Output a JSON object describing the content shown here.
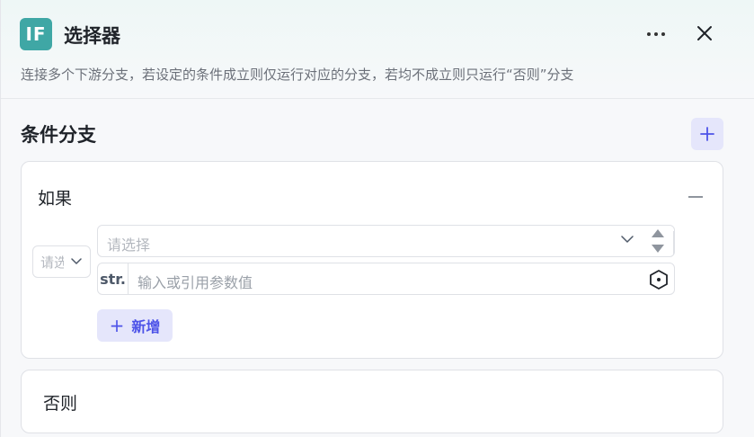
{
  "header": {
    "icon_text": "IF",
    "title": "选择器",
    "description": "连接多个下游分支，若设定的条件成立则仅运行对应的分支，若均不成立则只运行“否则”分支"
  },
  "branches": {
    "section_title": "条件分支",
    "if_card": {
      "label": "如果",
      "logic_placeholder": "请选择",
      "field_placeholder": "请选择",
      "value_type": "str.",
      "value_placeholder": "输入或引用参数值",
      "add_label": "新增"
    },
    "else_card": {
      "label": "否则"
    }
  },
  "colors": {
    "node_icon": "#3fa7a5",
    "accent": "#4d53e8",
    "accent_bg": "#e5e6fb"
  },
  "icons": {
    "more": "more-icon",
    "close": "close-icon",
    "add": "plus-icon",
    "collapse": "minus-icon",
    "chevron": "chevron-down-icon",
    "stepper": "stepper-icon",
    "reference": "variable-reference-icon"
  }
}
